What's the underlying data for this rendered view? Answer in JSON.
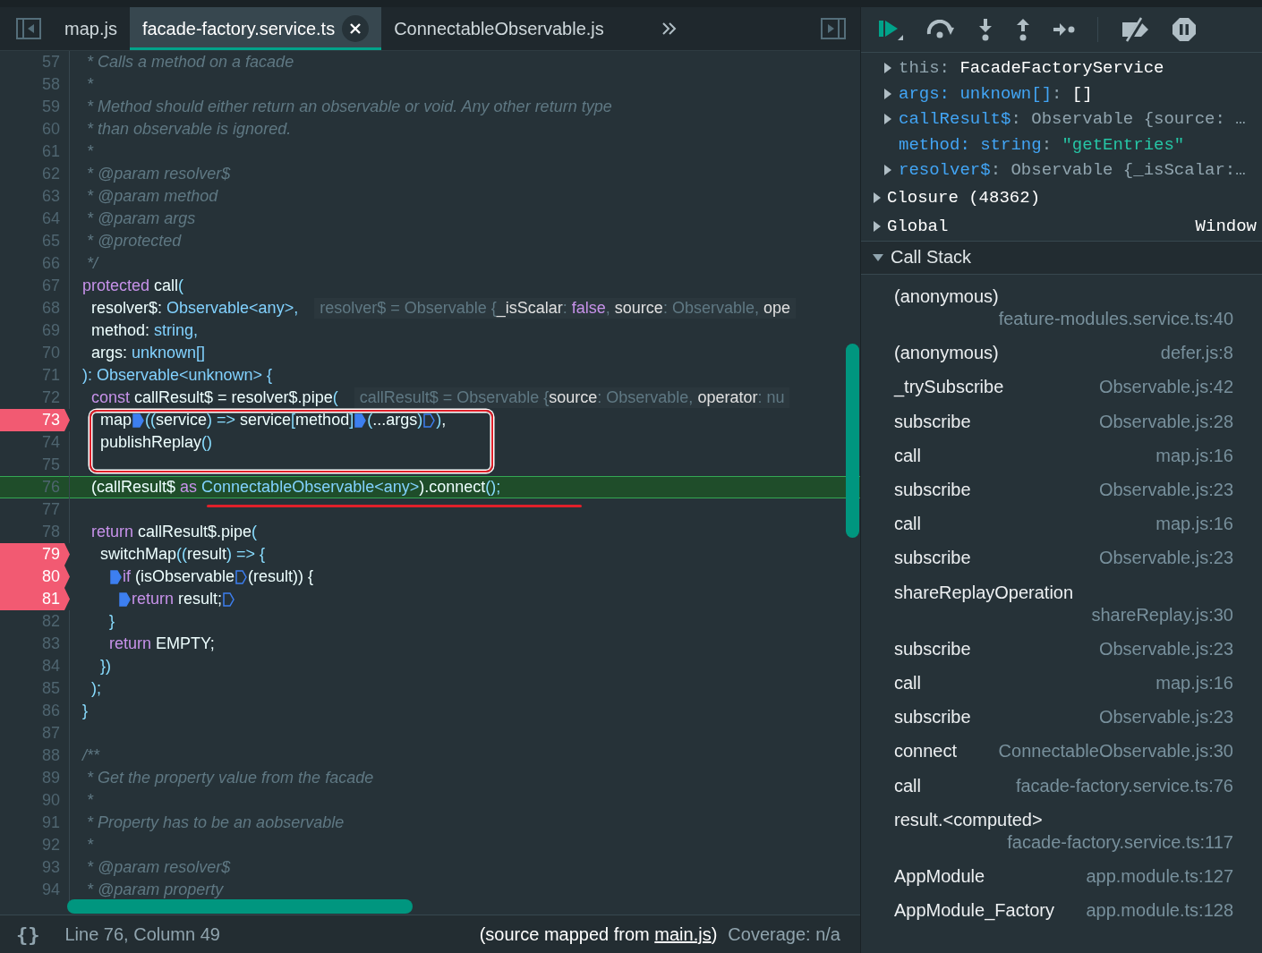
{
  "tabs": [
    {
      "label": "map.js",
      "selected": false
    },
    {
      "label": "facade-factory.service.ts",
      "selected": true
    },
    {
      "label": "ConnectableObservable.js",
      "selected": false
    }
  ],
  "code_lines": [
    {
      "num": "57",
      "breakpoint": false,
      "current": false,
      "segments": [
        {
          "kind": "code",
          "tokens": [
            {
              "text": " * Calls a method on a facade",
              "kind": "cm"
            }
          ]
        }
      ]
    },
    {
      "num": "58",
      "breakpoint": false,
      "current": false,
      "segments": [
        {
          "kind": "code",
          "tokens": [
            {
              "text": " *",
              "kind": "cm"
            }
          ]
        }
      ]
    },
    {
      "num": "59",
      "breakpoint": false,
      "current": false,
      "segments": [
        {
          "kind": "code",
          "tokens": [
            {
              "text": " * Method should either return an observable or void. Any other return type",
              "kind": "cm"
            }
          ]
        }
      ]
    },
    {
      "num": "60",
      "breakpoint": false,
      "current": false,
      "segments": [
        {
          "kind": "code",
          "tokens": [
            {
              "text": " * than observable is ignored.",
              "kind": "cm"
            }
          ]
        }
      ]
    },
    {
      "num": "61",
      "breakpoint": false,
      "current": false,
      "segments": [
        {
          "kind": "code",
          "tokens": [
            {
              "text": " *",
              "kind": "cm"
            }
          ]
        }
      ]
    },
    {
      "num": "62",
      "breakpoint": false,
      "current": false,
      "segments": [
        {
          "kind": "code",
          "tokens": [
            {
              "text": " * @param resolver$",
              "kind": "cm"
            }
          ]
        }
      ]
    },
    {
      "num": "63",
      "breakpoint": false,
      "current": false,
      "segments": [
        {
          "kind": "code",
          "tokens": [
            {
              "text": " * @param method",
              "kind": "cm"
            }
          ]
        }
      ]
    },
    {
      "num": "64",
      "breakpoint": false,
      "current": false,
      "segments": [
        {
          "kind": "code",
          "tokens": [
            {
              "text": " * @param args",
              "kind": "cm"
            }
          ]
        }
      ]
    },
    {
      "num": "65",
      "breakpoint": false,
      "current": false,
      "segments": [
        {
          "kind": "code",
          "tokens": [
            {
              "text": " * @protected",
              "kind": "cm"
            }
          ]
        }
      ]
    },
    {
      "num": "66",
      "breakpoint": false,
      "current": false,
      "segments": [
        {
          "kind": "code",
          "tokens": [
            {
              "text": " */",
              "kind": "cm"
            }
          ]
        }
      ]
    },
    {
      "num": "67",
      "breakpoint": false,
      "current": false,
      "segments": [
        {
          "kind": "code",
          "tokens": [
            {
              "text": "protected",
              "kind": "kw"
            },
            {
              "text": " call",
              "kind": "pl"
            },
            {
              "text": "(",
              "kind": "pn"
            }
          ]
        }
      ]
    },
    {
      "num": "68",
      "breakpoint": false,
      "current": false,
      "segments": [
        {
          "kind": "code",
          "tokens": [
            {
              "text": "  resolver$: ",
              "kind": "pl"
            },
            {
              "text": "Observable<any>,",
              "kind": "ty"
            }
          ]
        }
      ],
      "inline": [
        {
          "text": "resolver$ = Observable {",
          "kind": "dim"
        },
        {
          "text": "_isScalar",
          "kind": "key"
        },
        {
          "text": ": ",
          "kind": "dim"
        },
        {
          "text": "false",
          "kind": "bool"
        },
        {
          "text": ", ",
          "kind": "dim"
        },
        {
          "text": "source",
          "kind": "key"
        },
        {
          "text": ": Observable, ",
          "kind": "dim"
        },
        {
          "text": "ope",
          "kind": "key"
        }
      ]
    },
    {
      "num": "69",
      "breakpoint": false,
      "current": false,
      "segments": [
        {
          "kind": "code",
          "tokens": [
            {
              "text": "  method: ",
              "kind": "pl"
            },
            {
              "text": "string,",
              "kind": "ty"
            }
          ]
        }
      ]
    },
    {
      "num": "70",
      "breakpoint": false,
      "current": false,
      "segments": [
        {
          "kind": "code",
          "tokens": [
            {
              "text": "  args: ",
              "kind": "pl"
            },
            {
              "text": "unknown[]",
              "kind": "ty"
            }
          ]
        }
      ]
    },
    {
      "num": "71",
      "breakpoint": false,
      "current": false,
      "segments": [
        {
          "kind": "code",
          "tokens": [
            {
              "text": "): Observable<unknown> {",
              "kind": "ty"
            }
          ]
        }
      ]
    },
    {
      "num": "72",
      "breakpoint": false,
      "current": false,
      "segments": [
        {
          "kind": "code",
          "tokens": [
            {
              "text": "  const",
              "kind": "kw"
            },
            {
              "text": " callResult$ = resolver$.pipe",
              "kind": "pl"
            },
            {
              "text": "(",
              "kind": "pn"
            }
          ]
        }
      ],
      "inline": [
        {
          "text": "callResult$ = Observable {",
          "kind": "dim"
        },
        {
          "text": "source",
          "kind": "key"
        },
        {
          "text": ": Observable, ",
          "kind": "dim"
        },
        {
          "text": "operator",
          "kind": "key"
        },
        {
          "text": ": nu",
          "kind": "dim"
        }
      ]
    },
    {
      "num": "73",
      "breakpoint": true,
      "current": false,
      "segments": [
        {
          "kind": "code",
          "tokens": [
            {
              "text": "    map",
              "kind": "pl"
            }
          ]
        },
        {
          "kind": "marker",
          "active": true
        },
        {
          "kind": "code",
          "tokens": [
            {
              "text": "((",
              "kind": "pn"
            },
            {
              "text": "service",
              "kind": "pl"
            },
            {
              "text": ") => ",
              "kind": "pn"
            },
            {
              "text": "service",
              "kind": "pl"
            },
            {
              "text": "[",
              "kind": "pn"
            },
            {
              "text": "method",
              "kind": "pl"
            },
            {
              "text": "]",
              "kind": "pn"
            }
          ]
        },
        {
          "kind": "marker",
          "active": true
        },
        {
          "kind": "code",
          "tokens": [
            {
              "text": "(",
              "kind": "pn"
            },
            {
              "text": "...args",
              "kind": "pl"
            },
            {
              "text": ")",
              "kind": "pn"
            }
          ]
        },
        {
          "kind": "marker",
          "active": false
        },
        {
          "kind": "code",
          "tokens": [
            {
              "text": ")",
              "kind": "pn"
            },
            {
              "text": ",",
              "kind": "pl"
            }
          ]
        }
      ]
    },
    {
      "num": "74",
      "breakpoint": false,
      "current": false,
      "segments": [
        {
          "kind": "code",
          "tokens": [
            {
              "text": "    publishReplay",
              "kind": "pl"
            },
            {
              "text": "()",
              "kind": "pn"
            }
          ]
        }
      ]
    },
    {
      "num": "75",
      "breakpoint": false,
      "current": false
    },
    {
      "num": "76",
      "breakpoint": false,
      "current": true,
      "segments": [
        {
          "kind": "code",
          "tokens": [
            {
              "text": "  (callResult$ ",
              "kind": "pl"
            },
            {
              "text": "as",
              "kind": "kw"
            },
            {
              "text": " ConnectableObservable<any>",
              "kind": "ty"
            },
            {
              "text": ").connect",
              "kind": "pl"
            },
            {
              "text": "();",
              "kind": "pn"
            }
          ]
        }
      ]
    },
    {
      "num": "77",
      "breakpoint": false,
      "current": false
    },
    {
      "num": "78",
      "breakpoint": false,
      "current": false,
      "segments": [
        {
          "kind": "code",
          "tokens": [
            {
              "text": "  return",
              "kind": "kw"
            },
            {
              "text": " callResult$.pipe",
              "kind": "pl"
            },
            {
              "text": "(",
              "kind": "pn"
            }
          ]
        }
      ]
    },
    {
      "num": "79",
      "breakpoint": true,
      "current": false,
      "segments": [
        {
          "kind": "code",
          "tokens": [
            {
              "text": "    switchMap",
              "kind": "pl"
            },
            {
              "text": "((",
              "kind": "pn"
            },
            {
              "text": "result",
              "kind": "pl"
            },
            {
              "text": ") => {",
              "kind": "pn"
            }
          ]
        }
      ]
    },
    {
      "num": "80",
      "breakpoint": true,
      "current": false,
      "segments": [
        {
          "kind": "marker",
          "active": true
        },
        {
          "kind": "code",
          "tokens": [
            {
              "text": "if",
              "kind": "kw"
            },
            {
              "text": " (isObservable",
              "kind": "pl"
            }
          ]
        },
        {
          "kind": "marker",
          "active": false
        },
        {
          "kind": "code",
          "tokens": [
            {
              "text": "(result)) {",
              "kind": "pl"
            }
          ]
        }
      ]
    },
    {
      "num": "81",
      "breakpoint": true,
      "current": false,
      "segments": [
        {
          "kind": "marker",
          "active": true
        },
        {
          "kind": "code",
          "tokens": [
            {
              "text": "return",
              "kind": "kw"
            },
            {
              "text": " result;",
              "kind": "pl"
            }
          ]
        },
        {
          "kind": "marker",
          "active": false
        }
      ]
    },
    {
      "num": "82",
      "breakpoint": false,
      "current": false,
      "segments": [
        {
          "kind": "code",
          "tokens": [
            {
              "text": "      }",
              "kind": "pn"
            }
          ]
        }
      ]
    },
    {
      "num": "83",
      "breakpoint": false,
      "current": false,
      "segments": [
        {
          "kind": "code",
          "tokens": [
            {
              "text": "      return",
              "kind": "kw"
            },
            {
              "text": " EMPTY;",
              "kind": "pl"
            }
          ]
        }
      ]
    },
    {
      "num": "84",
      "breakpoint": false,
      "current": false,
      "segments": [
        {
          "kind": "code",
          "tokens": [
            {
              "text": "    })",
              "kind": "pn"
            }
          ]
        }
      ]
    },
    {
      "num": "85",
      "breakpoint": false,
      "current": false,
      "segments": [
        {
          "kind": "code",
          "tokens": [
            {
              "text": "  );",
              "kind": "pn"
            }
          ]
        }
      ]
    },
    {
      "num": "86",
      "breakpoint": false,
      "current": false,
      "segments": [
        {
          "kind": "code",
          "tokens": [
            {
              "text": "}",
              "kind": "pn"
            }
          ]
        }
      ]
    },
    {
      "num": "87",
      "breakpoint": false,
      "current": false
    },
    {
      "num": "88",
      "breakpoint": false,
      "current": false,
      "segments": [
        {
          "kind": "code",
          "tokens": [
            {
              "text": "/**",
              "kind": "cm"
            }
          ]
        }
      ]
    },
    {
      "num": "89",
      "breakpoint": false,
      "current": false,
      "segments": [
        {
          "kind": "code",
          "tokens": [
            {
              "text": " * Get the property value from the facade",
              "kind": "cm"
            }
          ]
        }
      ]
    },
    {
      "num": "90",
      "breakpoint": false,
      "current": false,
      "segments": [
        {
          "kind": "code",
          "tokens": [
            {
              "text": " *",
              "kind": "cm"
            }
          ]
        }
      ]
    },
    {
      "num": "91",
      "breakpoint": false,
      "current": false,
      "segments": [
        {
          "kind": "code",
          "tokens": [
            {
              "text": " * Property has to be an aobservable",
              "kind": "cm"
            }
          ]
        }
      ]
    },
    {
      "num": "92",
      "breakpoint": false,
      "current": false,
      "segments": [
        {
          "kind": "code",
          "tokens": [
            {
              "text": " *",
              "kind": "cm"
            }
          ]
        }
      ]
    },
    {
      "num": "93",
      "breakpoint": false,
      "current": false,
      "segments": [
        {
          "kind": "code",
          "tokens": [
            {
              "text": " * @param resolver$",
              "kind": "cm"
            }
          ]
        }
      ]
    },
    {
      "num": "94",
      "breakpoint": false,
      "current": false,
      "segments": [
        {
          "kind": "code",
          "tokens": [
            {
              "text": " * @param property",
              "kind": "cm"
            }
          ]
        }
      ]
    }
  ],
  "status_bar": {
    "format": "{}",
    "position": "Line 76, Column 49",
    "source_prefix": "(source mapped from ",
    "source_link": "main.js",
    "source_suffix": ")",
    "coverage": "Coverage: n/a"
  },
  "scope_variables": [
    {
      "expandable": true,
      "tokens": [
        {
          "text": "this: ",
          "kind": "dim"
        },
        {
          "text": "FacadeFactoryService",
          "kind": "bright"
        }
      ]
    },
    {
      "expandable": true,
      "tokens": [
        {
          "text": "args: unknown[]",
          "kind": "name"
        },
        {
          "text": ": ",
          "kind": "dim"
        },
        {
          "text": "[]",
          "kind": "bright"
        }
      ]
    },
    {
      "expandable": true,
      "tokens": [
        {
          "text": "callResult$",
          "kind": "name"
        },
        {
          "text": ": Observable {source: …",
          "kind": "dim"
        }
      ]
    },
    {
      "expandable": false,
      "tokens": [
        {
          "text": "method: string",
          "kind": "name"
        },
        {
          "text": ": ",
          "kind": "dim"
        },
        {
          "text": "\"getEntries\"",
          "kind": "string"
        }
      ]
    },
    {
      "expandable": true,
      "tokens": [
        {
          "text": "resolver$",
          "kind": "name"
        },
        {
          "text": ": Observable {_isScalar:…",
          "kind": "dim"
        }
      ]
    }
  ],
  "scopes": [
    {
      "label": "Closure (48362)"
    },
    {
      "label": "Global",
      "value": "Window"
    }
  ],
  "call_stack": {
    "title": "Call Stack",
    "expanded": true,
    "frames": [
      {
        "name": "(anonymous)",
        "location": "feature-modules.service.ts:40"
      },
      {
        "name": "(anonymous)",
        "location": "defer.js:8"
      },
      {
        "name": "_trySubscribe",
        "location": "Observable.js:42"
      },
      {
        "name": "subscribe",
        "location": "Observable.js:28"
      },
      {
        "name": "call",
        "location": "map.js:16"
      },
      {
        "name": "subscribe",
        "location": "Observable.js:23"
      },
      {
        "name": "call",
        "location": "map.js:16"
      },
      {
        "name": "subscribe",
        "location": "Observable.js:23"
      },
      {
        "name": "shareReplayOperation",
        "location": "shareReplay.js:30"
      },
      {
        "name": "subscribe",
        "location": "Observable.js:23"
      },
      {
        "name": "call",
        "location": "map.js:16"
      },
      {
        "name": "subscribe",
        "location": "Observable.js:23"
      },
      {
        "name": "connect",
        "location": "ConnectableObservable.js:30"
      },
      {
        "name": "call",
        "location": "facade-factory.service.ts:76"
      },
      {
        "name": "result.<computed>",
        "location": "facade-factory.service.ts:117"
      },
      {
        "name": "AppModule",
        "location": "app.module.ts:127"
      },
      {
        "name": "AppModule_Factory",
        "location": "app.module.ts:128"
      }
    ]
  }
}
